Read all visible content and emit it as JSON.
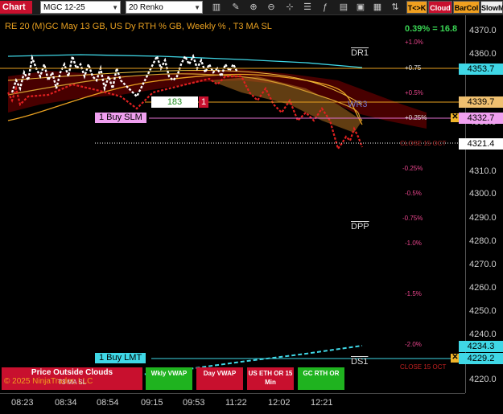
{
  "toolbar": {
    "chart_label": "Chart",
    "instrument": "MGC 12-25",
    "bar_type": "20 Renko",
    "buttons": [
      "T<>K",
      "Cloud",
      "BarCol",
      "SlowM"
    ]
  },
  "header": {
    "title": "RE 20  (M)GC May 13 GB, US Dy RTH % GB, Weekly % , T3 MA SL",
    "percent_readout": "0.39% = 16.8"
  },
  "levels": [
    "DR1",
    "WR3",
    "DPP",
    "DS1"
  ],
  "percent_labels": [
    "+1.0%",
    "+0.75",
    "+0.5%",
    "+0.25%",
    "-0.25%",
    "-0.5%",
    "-0.75%",
    "-1.0%",
    "-1.5%",
    "-2.0%"
  ],
  "close_labels": [
    "CLOSE 15 OCT",
    "CLOSE 15 OCT"
  ],
  "orders": {
    "buy_slm": "1 Buy SLM",
    "buy_lmt": "1 Buy LMT",
    "slm_qty": "183",
    "slm_count": "1"
  },
  "price_axis": [
    "4370.0",
    "4360.0",
    "4350.0",
    "4340.0",
    "4330.0",
    "4320.0",
    "4310.0",
    "4300.0",
    "4290.0",
    "4280.0",
    "4270.0",
    "4260.0",
    "4250.0",
    "4240.0",
    "4230.0",
    "4220.0"
  ],
  "price_tags": {
    "orange_1": "4353.7",
    "orange_2": "4339.7",
    "slm": "4332.7",
    "last": "4321.4",
    "lmt": "4234.3",
    "lower": "4229.2"
  },
  "bottom": {
    "banner": "Price Outside Clouds",
    "copyright": "© 2025 NinjaTrader, LLC",
    "t3": "T3 MA SL",
    "btn_wkly": "Wkly VWAP",
    "btn_day": "Day VWAP",
    "btn_us": "US ETH OR 15 Min",
    "btn_gc": "GC RTH OR"
  },
  "time_axis": [
    "08:23",
    "08:34",
    "08:54",
    "09:15",
    "09:53",
    "11:22",
    "12:02",
    "12:21"
  ],
  "colors": {
    "accent": "#c8102e",
    "cloud": "#8b0000",
    "green": "#1fb31f",
    "cyan": "#3fd7e6",
    "orange": "#e8a020"
  }
}
